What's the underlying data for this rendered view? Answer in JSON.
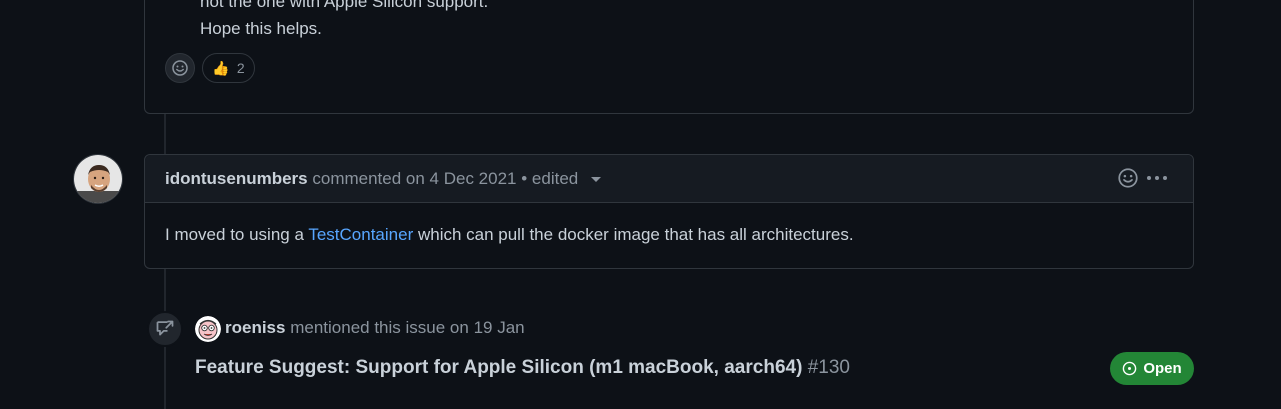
{
  "previous_comment": {
    "line_partial": "not the one with Apple Silicon support.",
    "line_last": "Hope this helps.",
    "reactions": [
      {
        "emoji": "👍",
        "count": "2"
      }
    ]
  },
  "comment": {
    "author": "idontusenumbers",
    "action": "commented on",
    "date": "4 Dec 2021",
    "separator": "•",
    "edited_label": "edited",
    "body_before": "I moved to using a ",
    "body_link": "TestContainer",
    "body_after": " which can pull the docker image that has all architectures."
  },
  "cross_reference": {
    "actor": "roeniss",
    "action": "mentioned this issue on",
    "date": "19 Jan",
    "issue_title": "Feature Suggest: Support for Apple Silicon (m1 macBook, aarch64)",
    "issue_number": "#130",
    "status": "Open",
    "status_color": "#238636"
  },
  "colors": {
    "background": "#0d1117",
    "link": "#58a6ff",
    "border": "#30363d"
  }
}
